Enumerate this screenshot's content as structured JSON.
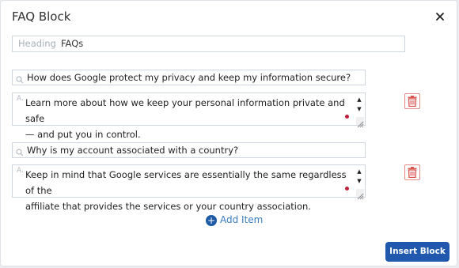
{
  "modal": {
    "title": "FAQ Block",
    "close_icon": "close-icon"
  },
  "heading": {
    "label": "Heading",
    "value": "FAQs"
  },
  "items": [
    {
      "question": "How does Google protect my privacy and keep my information secure?",
      "answer": "Learn more about how we keep your personal information private and safe\n— and put you in control."
    },
    {
      "question": "Why is my account associated with a country?",
      "answer": "Keep in mind that Google services are essentially the same regardless of the\naffiliate that provides the services or your country association."
    }
  ],
  "answer_icon_glyph": "A.",
  "add_item_label": "Add Item",
  "insert_button_label": "Insert Block",
  "colors": {
    "primary": "#1f58ad",
    "delete": "#d9534f",
    "indicator": "#c0203d"
  }
}
